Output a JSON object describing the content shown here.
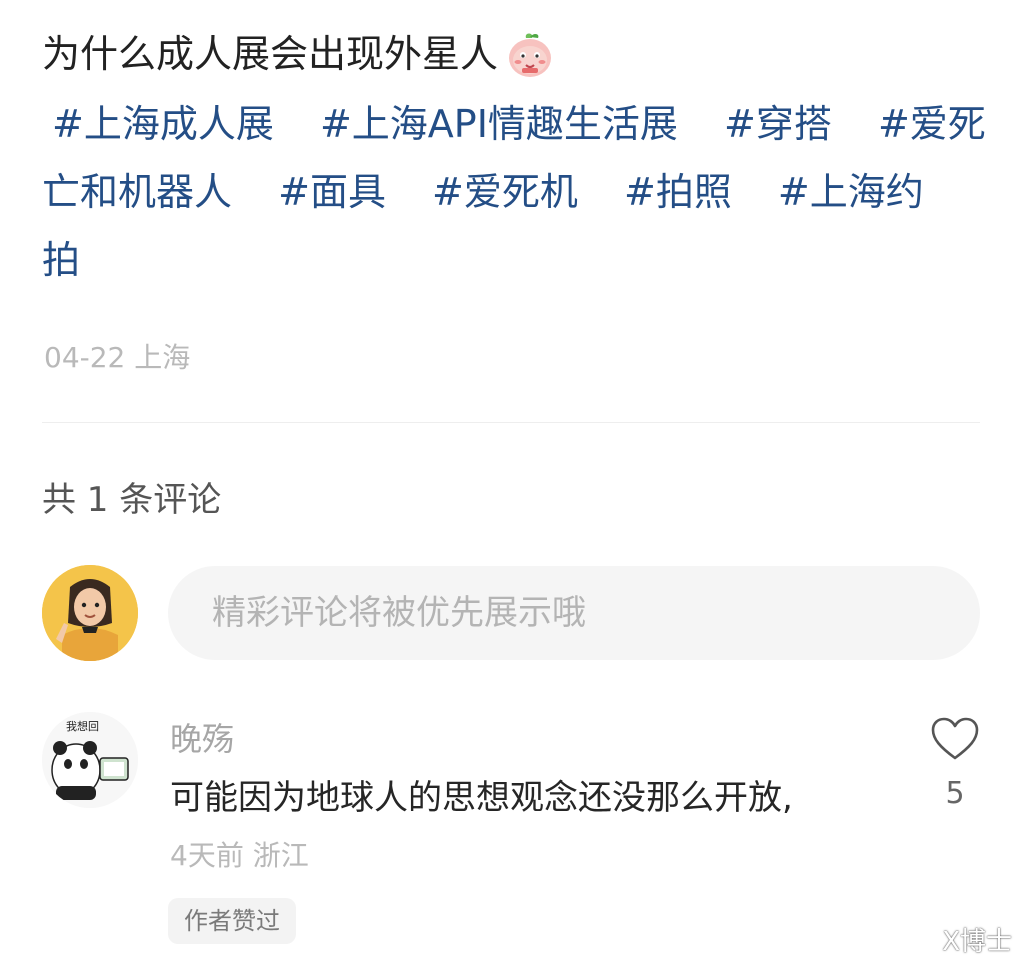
{
  "post": {
    "title": "为什么成人展会出现外星人",
    "tags": [
      "#上海成人展",
      "#上海API情趣生活展",
      "#穿搭",
      "#爱死亡和机器人",
      "#面具",
      "#爱死机",
      "#拍照",
      "#上海约拍"
    ],
    "meta": "04-22 上海"
  },
  "comments_section": {
    "count_label": "共 1 条评论",
    "input_placeholder": "精彩评论将被优先展示哦"
  },
  "comment": {
    "username": "晚殇",
    "avatar_text": "我想回",
    "text": "可能因为地球人的思想观念还没那么开放,",
    "time_location": "4天前 浙江",
    "like_count": "5",
    "author_liked_label": "作者赞过"
  },
  "watermark": {
    "text": "X博士"
  },
  "colors": {
    "tag": "#244e86",
    "muted": "#b9b9b9",
    "avatar_bg": "#f4c44a"
  }
}
